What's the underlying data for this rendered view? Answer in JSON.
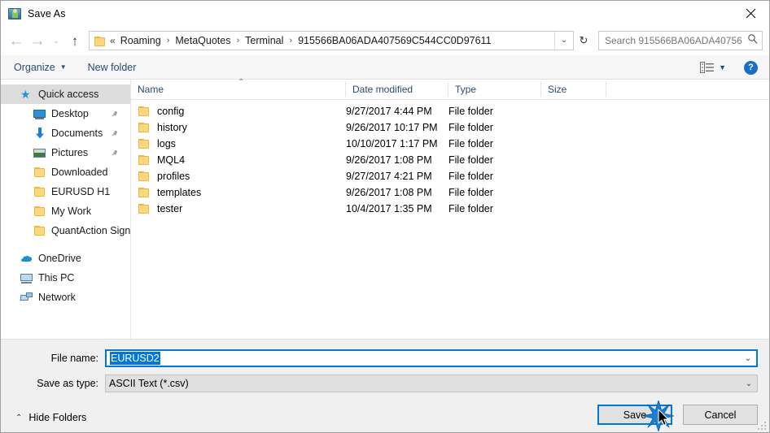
{
  "window": {
    "title": "Save As",
    "close_label": "✕"
  },
  "nav": {
    "back_label": "←",
    "forward_label": "→",
    "history_label": "⌄",
    "up_label": "↑",
    "refresh_label": "↻",
    "address_caret": "⌄",
    "breadcrumb_prefix": "«",
    "breadcrumbs": [
      "Roaming",
      "MetaQuotes",
      "Terminal",
      "915566BA06ADA407569C544CC0D97611"
    ],
    "separator": "›"
  },
  "search": {
    "placeholder": "Search 915566BA06ADA40756...",
    "icon": "search-icon"
  },
  "toolbar": {
    "organize_label": "Organize",
    "organize_caret": "▼",
    "new_folder_label": "New folder",
    "view_caret": "▼",
    "help_label": "?"
  },
  "sidebar": {
    "items": [
      {
        "label": "Quick access",
        "icon": "star-icon",
        "level": 0,
        "selected": true,
        "pinned": false
      },
      {
        "label": "Desktop",
        "icon": "desktop-icon",
        "level": 1,
        "selected": false,
        "pinned": true
      },
      {
        "label": "Documents",
        "icon": "documents-icon",
        "level": 1,
        "selected": false,
        "pinned": true
      },
      {
        "label": "Pictures",
        "icon": "pictures-icon",
        "level": 1,
        "selected": false,
        "pinned": true
      },
      {
        "label": "Downloaded",
        "icon": "folder-icon",
        "level": 1,
        "selected": false,
        "pinned": false
      },
      {
        "label": "EURUSD H1",
        "icon": "folder-icon",
        "level": 1,
        "selected": false,
        "pinned": false
      },
      {
        "label": "My Work",
        "icon": "folder-icon",
        "level": 1,
        "selected": false,
        "pinned": false
      },
      {
        "label": "QuantAction Signal",
        "icon": "folder-icon",
        "level": 1,
        "selected": false,
        "pinned": false
      },
      {
        "label": "OneDrive",
        "icon": "onedrive-icon",
        "level": 0,
        "selected": false,
        "pinned": false
      },
      {
        "label": "This PC",
        "icon": "this-pc-icon",
        "level": 0,
        "selected": false,
        "pinned": false
      },
      {
        "label": "Network",
        "icon": "network-icon",
        "level": 0,
        "selected": false,
        "pinned": false
      }
    ]
  },
  "filelist": {
    "columns": [
      "Name",
      "Date modified",
      "Type",
      "Size"
    ],
    "sort_indicator": "⌃",
    "rows": [
      {
        "name": "config",
        "date": "9/27/2017 4:44 PM",
        "type": "File folder",
        "size": ""
      },
      {
        "name": "history",
        "date": "9/26/2017 10:17 PM",
        "type": "File folder",
        "size": ""
      },
      {
        "name": "logs",
        "date": "10/10/2017 1:17 PM",
        "type": "File folder",
        "size": ""
      },
      {
        "name": "MQL4",
        "date": "9/26/2017 1:08 PM",
        "type": "File folder",
        "size": ""
      },
      {
        "name": "profiles",
        "date": "9/27/2017 4:21 PM",
        "type": "File folder",
        "size": ""
      },
      {
        "name": "templates",
        "date": "9/26/2017 1:08 PM",
        "type": "File folder",
        "size": ""
      },
      {
        "name": "tester",
        "date": "10/4/2017 1:35 PM",
        "type": "File folder",
        "size": ""
      }
    ]
  },
  "form": {
    "filename_label": "File name:",
    "filename_value": "EURUSD2",
    "filetype_label": "Save as type:",
    "filetype_value": "ASCII Text (*.csv)",
    "combo_caret": "⌄"
  },
  "footer": {
    "hide_folders_label": "Hide Folders",
    "hide_folders_caret": "⌃",
    "save_label": "Save",
    "cancel_label": "Cancel"
  },
  "colors": {
    "accent": "#0078d7",
    "folder": "#fcd77f",
    "header_text": "#2b4b6e",
    "selection": "#dcdcdc"
  }
}
